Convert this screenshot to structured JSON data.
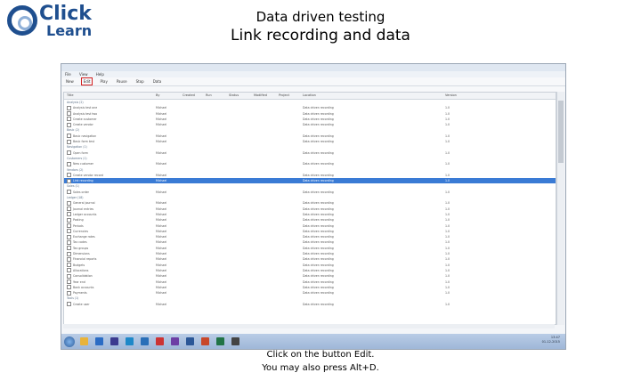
{
  "logo": {
    "top_word": "Click",
    "bottom_word": "Learn"
  },
  "slide": {
    "title": "Data driven testing",
    "subtitle": "Link recording and data",
    "caption_line1": "Click on the button Edit.",
    "caption_line2": "You may also press Alt+D."
  },
  "app": {
    "menu": [
      "File",
      "View",
      "Help"
    ],
    "toolbar": [
      "New",
      "Edit",
      "Play",
      "Pause",
      "Stop",
      "Data"
    ]
  },
  "grid": {
    "columns": [
      "Title",
      "By",
      "Created",
      "Run",
      "Status",
      "Modified",
      "Project",
      "Location",
      "Version"
    ],
    "rows": [
      {
        "type": "group",
        "text": "Analysis (2)"
      },
      {
        "type": "item",
        "cells": [
          "Analysis test one",
          "Michael",
          "",
          "",
          "",
          "",
          "",
          "Data driven recording",
          "1.0"
        ]
      },
      {
        "type": "item",
        "cells": [
          "Analysis test two",
          "Michael",
          "",
          "",
          "",
          "",
          "",
          "Data driven recording",
          "1.0"
        ]
      },
      {
        "type": "item",
        "cells": [
          "Create customer",
          "Michael",
          "",
          "",
          "",
          "",
          "",
          "Data driven recording",
          "1.0"
        ]
      },
      {
        "type": "item",
        "cells": [
          "Create vendor",
          "Michael",
          "",
          "",
          "",
          "",
          "",
          "Data driven recording",
          "1.0"
        ]
      },
      {
        "type": "group",
        "text": "Basic (2)"
      },
      {
        "type": "item",
        "cells": [
          "Basic navigation",
          "Michael",
          "",
          "",
          "",
          "",
          "",
          "Data driven recording",
          "1.0"
        ]
      },
      {
        "type": "item",
        "cells": [
          "Basic form test",
          "Michael",
          "",
          "",
          "",
          "",
          "",
          "Data driven recording",
          "1.0"
        ]
      },
      {
        "type": "group",
        "text": "Navigation (1)"
      },
      {
        "type": "item",
        "cells": [
          "Open form",
          "Michael",
          "",
          "",
          "",
          "",
          "",
          "Data driven recording",
          "1.0"
        ]
      },
      {
        "type": "group",
        "text": "Customers (1)"
      },
      {
        "type": "item",
        "cells": [
          "New customer",
          "Michael",
          "",
          "",
          "",
          "",
          "",
          "Data driven recording",
          "1.0"
        ]
      },
      {
        "type": "group",
        "text": "Vendors (2)"
      },
      {
        "type": "item",
        "cells": [
          "Create vendor record",
          "Michael",
          "",
          "",
          "",
          "",
          "",
          "Data driven recording",
          "1.0"
        ]
      },
      {
        "type": "selected",
        "cells": [
          "Link recording",
          "Michael",
          "",
          "",
          "",
          "",
          "",
          "Data driven recording",
          "1.0"
        ]
      },
      {
        "type": "group",
        "text": "Sales (1)"
      },
      {
        "type": "item",
        "cells": [
          "Sales order",
          "Michael",
          "",
          "",
          "",
          "",
          "",
          "Data driven recording",
          "1.0"
        ]
      },
      {
        "type": "group",
        "text": "Ledger (18)"
      },
      {
        "type": "item",
        "cells": [
          "General journal",
          "Michael",
          "",
          "",
          "",
          "",
          "",
          "Data driven recording",
          "1.0"
        ]
      },
      {
        "type": "item",
        "cells": [
          "Journal entries",
          "Michael",
          "",
          "",
          "",
          "",
          "",
          "Data driven recording",
          "1.0"
        ]
      },
      {
        "type": "item",
        "cells": [
          "Ledger accounts",
          "Michael",
          "",
          "",
          "",
          "",
          "",
          "Data driven recording",
          "1.0"
        ]
      },
      {
        "type": "item",
        "cells": [
          "Posting",
          "Michael",
          "",
          "",
          "",
          "",
          "",
          "Data driven recording",
          "1.0"
        ]
      },
      {
        "type": "item",
        "cells": [
          "Periods",
          "Michael",
          "",
          "",
          "",
          "",
          "",
          "Data driven recording",
          "1.0"
        ]
      },
      {
        "type": "item",
        "cells": [
          "Currencies",
          "Michael",
          "",
          "",
          "",
          "",
          "",
          "Data driven recording",
          "1.0"
        ]
      },
      {
        "type": "item",
        "cells": [
          "Exchange rates",
          "Michael",
          "",
          "",
          "",
          "",
          "",
          "Data driven recording",
          "1.0"
        ]
      },
      {
        "type": "item",
        "cells": [
          "Tax codes",
          "Michael",
          "",
          "",
          "",
          "",
          "",
          "Data driven recording",
          "1.0"
        ]
      },
      {
        "type": "item",
        "cells": [
          "Tax groups",
          "Michael",
          "",
          "",
          "",
          "",
          "",
          "Data driven recording",
          "1.0"
        ]
      },
      {
        "type": "item",
        "cells": [
          "Dimensions",
          "Michael",
          "",
          "",
          "",
          "",
          "",
          "Data driven recording",
          "1.0"
        ]
      },
      {
        "type": "item",
        "cells": [
          "Financial reports",
          "Michael",
          "",
          "",
          "",
          "",
          "",
          "Data driven recording",
          "1.0"
        ]
      },
      {
        "type": "item",
        "cells": [
          "Budgets",
          "Michael",
          "",
          "",
          "",
          "",
          "",
          "Data driven recording",
          "1.0"
        ]
      },
      {
        "type": "item",
        "cells": [
          "Allocations",
          "Michael",
          "",
          "",
          "",
          "",
          "",
          "Data driven recording",
          "1.0"
        ]
      },
      {
        "type": "item",
        "cells": [
          "Consolidation",
          "Michael",
          "",
          "",
          "",
          "",
          "",
          "Data driven recording",
          "1.0"
        ]
      },
      {
        "type": "item",
        "cells": [
          "Year end",
          "Michael",
          "",
          "",
          "",
          "",
          "",
          "Data driven recording",
          "1.0"
        ]
      },
      {
        "type": "item",
        "cells": [
          "Bank accounts",
          "Michael",
          "",
          "",
          "",
          "",
          "",
          "Data driven recording",
          "1.0"
        ]
      },
      {
        "type": "item",
        "cells": [
          "Payments",
          "Michael",
          "",
          "",
          "",
          "",
          "",
          "Data driven recording",
          "1.0"
        ]
      },
      {
        "type": "group",
        "text": "Tools (1)"
      },
      {
        "type": "item",
        "cells": [
          "Create user",
          "Michael",
          "",
          "",
          "",
          "",
          "",
          "Data driven recording",
          "1.0"
        ]
      }
    ]
  },
  "tray": {
    "time": "13:47",
    "date": "01-12-2015"
  },
  "colors": {
    "accent": "#1f4f8f",
    "selection": "#3a7bd5",
    "highlight_box": "#d42020"
  }
}
